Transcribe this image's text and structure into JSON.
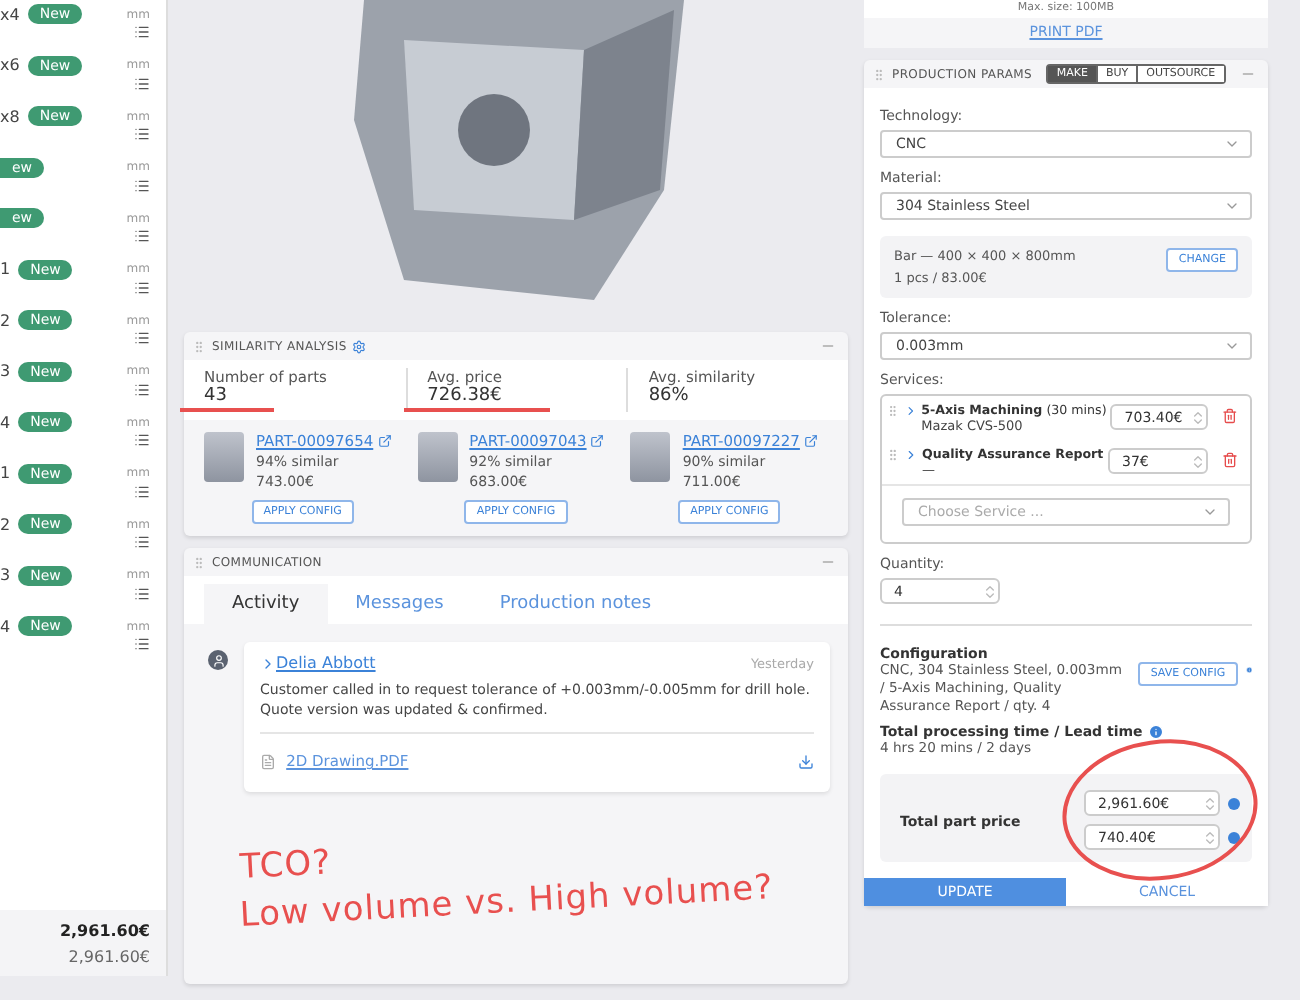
{
  "parts_list": {
    "rows": [
      {
        "label": "x4",
        "badge": "New",
        "unit": "mm"
      },
      {
        "label": "x6",
        "badge": "New",
        "unit": "mm"
      },
      {
        "label": "x8",
        "badge": "New",
        "unit": "mm"
      },
      {
        "label": "",
        "badge": "ew",
        "unit": "mm"
      },
      {
        "label": "",
        "badge": "ew",
        "unit": "mm"
      },
      {
        "label": "1",
        "badge": "New",
        "unit": "mm"
      },
      {
        "label": "2",
        "badge": "New",
        "unit": "mm"
      },
      {
        "label": "3",
        "badge": "New",
        "unit": "mm"
      },
      {
        "label": "4",
        "badge": "New",
        "unit": "mm"
      },
      {
        "label": "1",
        "badge": "New",
        "unit": "mm"
      },
      {
        "label": "2",
        "badge": "New",
        "unit": "mm"
      },
      {
        "label": "3",
        "badge": "New",
        "unit": "mm"
      },
      {
        "label": "4",
        "badge": "New",
        "unit": "mm"
      }
    ],
    "totals": [
      "2,961.60€",
      "2,961.60€"
    ]
  },
  "similarity": {
    "title": "SIMILARITY ANALYSIS",
    "stats": [
      {
        "label": "Number of parts",
        "value": "43",
        "marked": true
      },
      {
        "label": "Avg. price",
        "value": "726.38€",
        "marked": true
      },
      {
        "label": "Avg. similarity",
        "value": "86%",
        "marked": false
      }
    ],
    "parts": [
      {
        "id": "PART-00097654",
        "similarity": "94% similar",
        "price": "743.00€",
        "action": "APPLY CONFIG"
      },
      {
        "id": "PART-00097043",
        "similarity": "92% similar",
        "price": "683.00€",
        "action": "APPLY CONFIG"
      },
      {
        "id": "PART-00097227",
        "similarity": "90% similar",
        "price": "711.00€",
        "action": "APPLY CONFIG"
      }
    ]
  },
  "communication": {
    "title": "COMMUNICATION",
    "tabs": [
      {
        "label": "Activity",
        "selected": true
      },
      {
        "label": "Messages",
        "selected": false
      },
      {
        "label": "Production notes",
        "selected": false
      }
    ],
    "activity": [
      {
        "author": "Delia Abbott",
        "time": "Yesterday",
        "text": "Customer called in to request tolerance of +0.003mm/-0.005mm for drill hole. Quote version was updated & confirmed.",
        "attachment": "2D Drawing.PDF"
      }
    ]
  },
  "annotation": {
    "lines": [
      "TCO?",
      "Low volume vs. High volume?"
    ]
  },
  "print": {
    "max_size": "Max. size: 100MB",
    "label": "PRINT PDF"
  },
  "production": {
    "title": "PRODUCTION PARAMS",
    "modes": [
      {
        "label": "MAKE",
        "selected": true
      },
      {
        "label": "BUY",
        "selected": false
      },
      {
        "label": "OUTSOURCE",
        "selected": false
      }
    ],
    "technology": {
      "label": "Technology:",
      "value": "CNC"
    },
    "material": {
      "label": "Material:",
      "value": "304 Stainless Steel"
    },
    "stock": {
      "line1": "Bar — 400 × 400 × 800mm",
      "line2": "1 pcs / 83.00€",
      "action": "CHANGE"
    },
    "tolerance": {
      "label": "Tolerance:",
      "value": "0.003mm"
    },
    "services": {
      "label": "Services:",
      "items": [
        {
          "name": "5-Axis Machining",
          "duration": "(30 mins)",
          "detail": "Mazak CVS-500",
          "price": "703.40€"
        },
        {
          "name": "Quality Assurance Report",
          "detail": "—",
          "price": "37€"
        }
      ],
      "placeholder": "Choose Service ..."
    },
    "quantity": {
      "label": "Quantity:",
      "value": "4"
    },
    "configuration": {
      "label": "Configuration",
      "text": "CNC, 304 Stainless Steel, 0.003mm / 5-Axis Machining, Quality Assurance Report / qty. 4",
      "action": "SAVE CONFIG"
    },
    "processing": {
      "label": "Total processing time / Lead time",
      "value": "4 hrs 20 mins / 2 days"
    },
    "price": {
      "label": "Total part price",
      "values": [
        "2,961.60€",
        "740.40€"
      ]
    },
    "buttons": [
      {
        "label": "UPDATE",
        "kind": "primary"
      },
      {
        "label": "CANCEL",
        "kind": "secondary"
      }
    ]
  }
}
